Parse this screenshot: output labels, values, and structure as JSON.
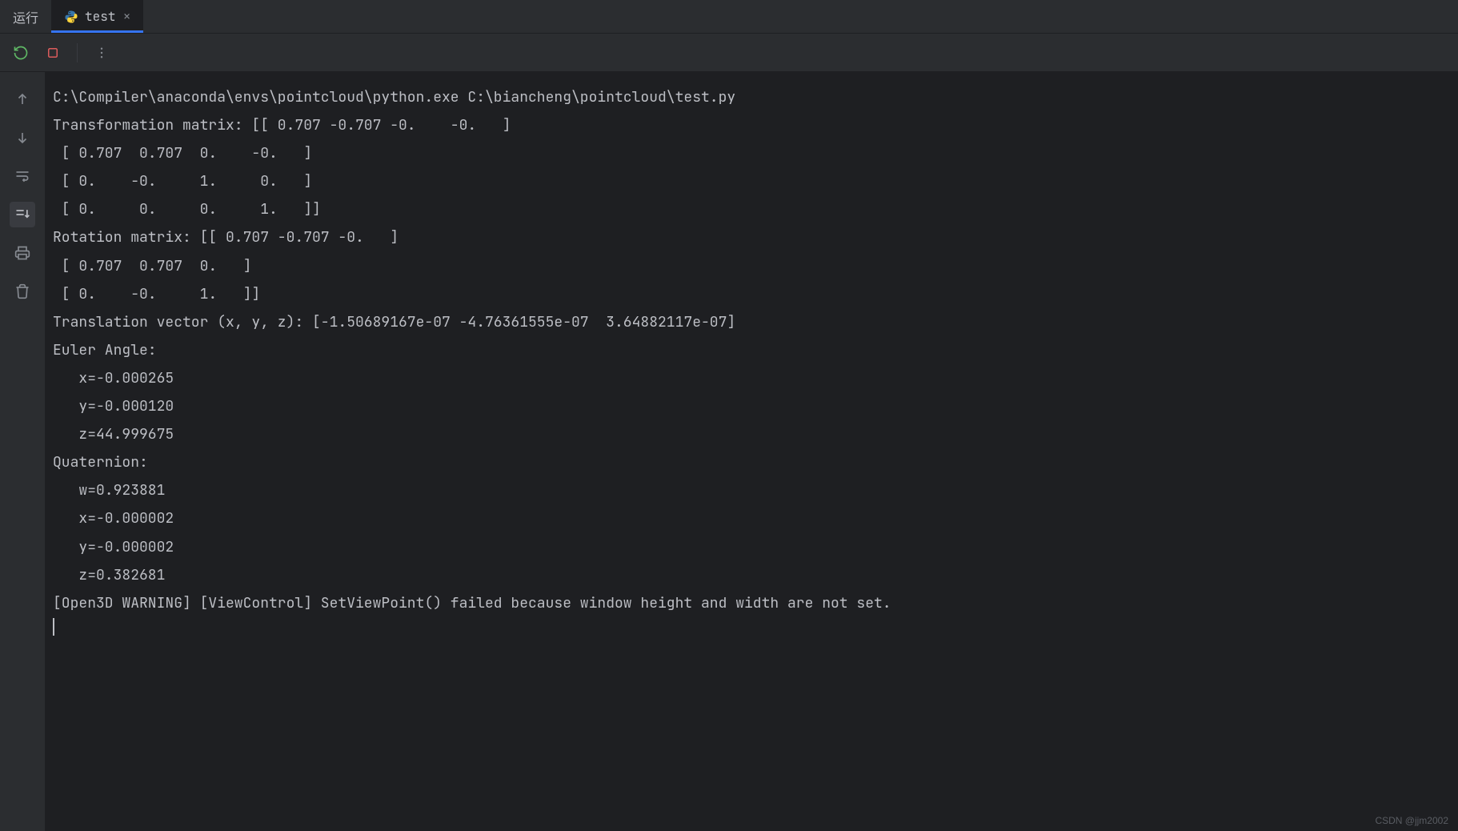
{
  "tabs": {
    "run": "运行",
    "test": "test"
  },
  "console_output": "C:\\Compiler\\anaconda\\envs\\pointcloud\\python.exe C:\\biancheng\\pointcloud\\test.py\nTransformation matrix: [[ 0.707 -0.707 -0.    -0.   ]\n [ 0.707  0.707  0.    -0.   ]\n [ 0.    -0.     1.     0.   ]\n [ 0.     0.     0.     1.   ]]\nRotation matrix: [[ 0.707 -0.707 -0.   ]\n [ 0.707  0.707  0.   ]\n [ 0.    -0.     1.   ]]\nTranslation vector (x, y, z): [-1.50689167e-07 -4.76361555e-07  3.64882117e-07]\nEuler Angle:\n   x=-0.000265\n   y=-0.000120\n   z=44.999675\nQuaternion:\n   w=0.923881\n   x=-0.000002\n   y=-0.000002\n   z=0.382681\n[Open3D WARNING] [ViewControl] SetViewPoint() failed because window height and width are not set.",
  "watermark": "CSDN @jjm2002"
}
